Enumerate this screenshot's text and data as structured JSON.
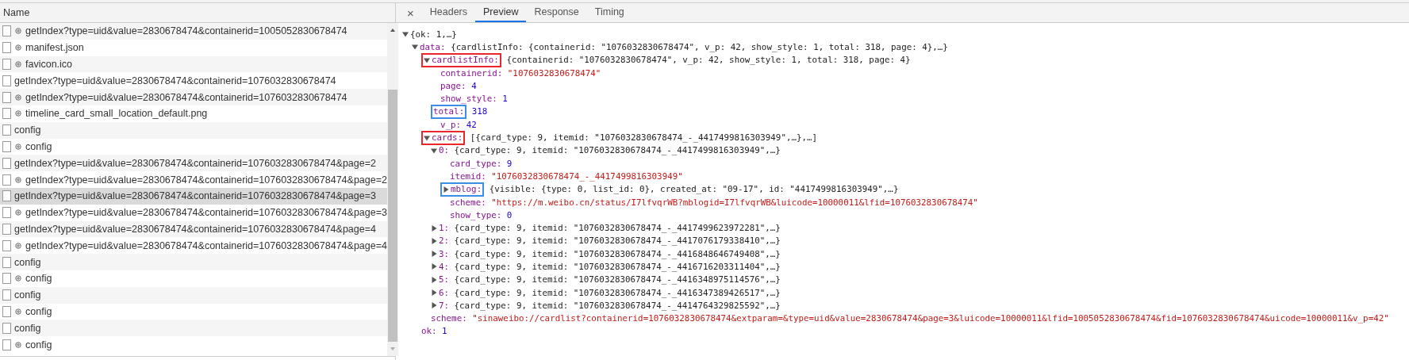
{
  "requests": {
    "header": "Name",
    "rows": [
      {
        "name": "getIndex?type=uid&value=2830678474&containerid=1005052830678474",
        "kind": "service_worker",
        "selected": false
      },
      {
        "name": "manifest.json",
        "kind": "service_worker",
        "selected": false
      },
      {
        "name": "favicon.ico",
        "kind": "service_worker",
        "selected": false
      },
      {
        "name": "getIndex?type=uid&value=2830678474&containerid=1076032830678474",
        "kind": "request",
        "selected": false
      },
      {
        "name": "getIndex?type=uid&value=2830678474&containerid=1076032830678474",
        "kind": "service_worker",
        "selected": false
      },
      {
        "name": "timeline_card_small_location_default.png",
        "kind": "service_worker",
        "selected": false
      },
      {
        "name": "config",
        "kind": "request",
        "selected": false
      },
      {
        "name": "config",
        "kind": "service_worker",
        "selected": false
      },
      {
        "name": "getIndex?type=uid&value=2830678474&containerid=1076032830678474&page=2",
        "kind": "request",
        "selected": false
      },
      {
        "name": "getIndex?type=uid&value=2830678474&containerid=1076032830678474&page=2",
        "kind": "service_worker",
        "selected": false
      },
      {
        "name": "getIndex?type=uid&value=2830678474&containerid=1076032830678474&page=3",
        "kind": "request",
        "selected": true
      },
      {
        "name": "getIndex?type=uid&value=2830678474&containerid=1076032830678474&page=3",
        "kind": "service_worker",
        "selected": false
      },
      {
        "name": "getIndex?type=uid&value=2830678474&containerid=1076032830678474&page=4",
        "kind": "request",
        "selected": false
      },
      {
        "name": "getIndex?type=uid&value=2830678474&containerid=1076032830678474&page=4",
        "kind": "service_worker",
        "selected": false
      },
      {
        "name": "config",
        "kind": "request",
        "selected": false
      },
      {
        "name": "config",
        "kind": "service_worker",
        "selected": false
      },
      {
        "name": "config",
        "kind": "request",
        "selected": false
      },
      {
        "name": "config",
        "kind": "service_worker",
        "selected": false
      },
      {
        "name": "config",
        "kind": "request",
        "selected": false
      },
      {
        "name": "config",
        "kind": "service_worker",
        "selected": false
      }
    ]
  },
  "details": {
    "close": "×",
    "tabs": [
      {
        "label": "Headers",
        "selected": false
      },
      {
        "label": "Preview",
        "selected": true
      },
      {
        "label": "Response",
        "selected": false
      },
      {
        "label": "Timing",
        "selected": false
      }
    ],
    "preview": {
      "expanded": true,
      "summary": "{ok: 1,…}",
      "children": [
        {
          "key": "data:",
          "expanded": true,
          "summary": "{cardlistInfo: {containerid: \"1076032830678474\", v_p: 42, show_style: 1, total: 318, page: 4},…}",
          "children": [
            {
              "key": "cardlistInfo:",
              "expanded": true,
              "color": "#e8262b",
              "summary": "{containerid: \"1076032830678474\", v_p: 42, show_style: 1, total: 318, page: 4}",
              "children": [
                {
                  "key": "containerid:",
                  "kind": "string",
                  "value": "\"1076032830678474\""
                },
                {
                  "key": "page:",
                  "kind": "number",
                  "value": "4"
                },
                {
                  "key": "show_style:",
                  "kind": "number",
                  "value": "1"
                },
                {
                  "key": "total:",
                  "kind": "number",
                  "value": "318",
                  "color": "#3a8ee6"
                },
                {
                  "key": "v_p:",
                  "kind": "number",
                  "value": "42"
                }
              ]
            },
            {
              "key": "cards:",
              "expanded": true,
              "color": "#e8262b",
              "summary": "[{card_type: 9, itemid: \"1076032830678474_-_4417499816303949\",…},…]",
              "children": [
                {
                  "key": "0:",
                  "expanded": true,
                  "summary": "{card_type: 9, itemid: \"1076032830678474_-_4417499816303949\",…}",
                  "children": [
                    {
                      "key": "card_type:",
                      "kind": "number",
                      "value": "9"
                    },
                    {
                      "key": "itemid:",
                      "kind": "string",
                      "value": "\"1076032830678474_-_4417499816303949\""
                    },
                    {
                      "key": "mblog:",
                      "expanded": false,
                      "color": "#3a8ee6",
                      "summary": "{visible: {type: 0, list_id: 0}, created_at: \"09-17\", id: \"4417499816303949\",…}"
                    },
                    {
                      "key": "scheme:",
                      "kind": "string",
                      "value": "\"https://m.weibo.cn/status/I7lfvqrWB?mblogid=I7lfvqrWB&luicode=10000011&lfid=1076032830678474\""
                    },
                    {
                      "key": "show_type:",
                      "kind": "number",
                      "value": "0"
                    }
                  ]
                },
                {
                  "key": "1:",
                  "expanded": false,
                  "summary": "{card_type: 9, itemid: \"1076032830678474_-_4417499623972281\",…}"
                },
                {
                  "key": "2:",
                  "expanded": false,
                  "summary": "{card_type: 9, itemid: \"1076032830678474_-_4417076179338410\",…}"
                },
                {
                  "key": "3:",
                  "expanded": false,
                  "summary": "{card_type: 9, itemid: \"1076032830678474_-_4416848646749408\",…}"
                },
                {
                  "key": "4:",
                  "expanded": false,
                  "summary": "{card_type: 9, itemid: \"1076032830678474_-_4416716203311404\",…}"
                },
                {
                  "key": "5:",
                  "expanded": false,
                  "summary": "{card_type: 9, itemid: \"1076032830678474_-_4416348975114576\",…}"
                },
                {
                  "key": "6:",
                  "expanded": false,
                  "summary": "{card_type: 9, itemid: \"1076032830678474_-_4416347389426517\",…}"
                },
                {
                  "key": "7:",
                  "expanded": false,
                  "summary": "{card_type: 9, itemid: \"1076032830678474_-_4414764329825592\",…}"
                }
              ]
            },
            {
              "key": "scheme:",
              "kind": "string",
              "value": "\"sinaweibo://cardlist?containerid=1076032830678474&extparam=&type=uid&value=2830678474&page=3&luicode=10000011&lfid=1005052830678474&fid=1076032830678474&uicode=10000011&v_p=42\""
            }
          ]
        },
        {
          "key": "ok:",
          "kind": "number",
          "value": "1"
        }
      ]
    }
  }
}
